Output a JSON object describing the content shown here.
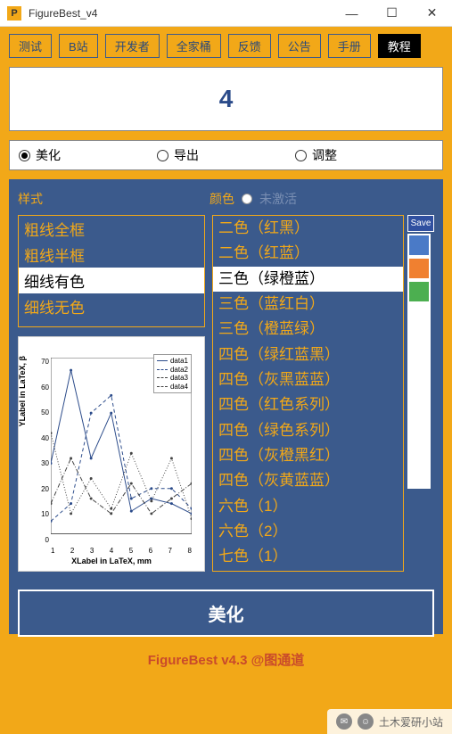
{
  "window": {
    "title": "FigureBest_v4",
    "icon_letter": "P"
  },
  "toolbar": {
    "buttons": [
      "测试",
      "B站",
      "开发者",
      "全家桶",
      "反馈",
      "公告",
      "手册",
      "教程"
    ]
  },
  "display": {
    "value": "4"
  },
  "tabs": {
    "options": [
      "美化",
      "导出",
      "调整"
    ],
    "selected": 0
  },
  "panel": {
    "style_header": "样式",
    "color_header": "颜色",
    "inactive_label": "未激活",
    "styles": [
      "粗线全框",
      "粗线半框",
      "细线有色",
      "细线无色"
    ],
    "selected_style": 2,
    "colors": [
      "二色（红黑）",
      "二色（红蓝）",
      "三色（绿橙蓝）",
      "三色（蓝红白）",
      "三色（橙蓝绿）",
      "四色（绿红蓝黑）",
      "四色（灰黑蓝蓝）",
      "四色（红色系列）",
      "四色（绿色系列）",
      "四色（灰橙黑红）",
      "四色（灰黄蓝蓝）",
      "六色（1）",
      "六色（2）",
      "七色（1）"
    ],
    "selected_color": 2,
    "save_label": "Save",
    "swatches": [
      "#4a7ac7",
      "#f08030",
      "#4caf50",
      "#ffffff",
      "#ffffff",
      "#ffffff",
      "#ffffff",
      "#ffffff",
      "#ffffff",
      "#ffffff",
      "#ffffff"
    ]
  },
  "action": {
    "label": "美化"
  },
  "footer": {
    "text": "FigureBest v4.3 @图通道"
  },
  "wechat": {
    "label": "土木爱研小站"
  },
  "chart_data": {
    "type": "line",
    "xlabel": "XLabel in LaTeX, mm",
    "ylabel": "YLabel in LaTeX, β",
    "x": [
      1,
      2,
      3,
      4,
      5,
      6,
      7,
      8
    ],
    "xlim": [
      1,
      8
    ],
    "ylim": [
      0,
      70
    ],
    "y_ticks": [
      0,
      10,
      20,
      30,
      40,
      50,
      60,
      70
    ],
    "x_ticks": [
      1,
      2,
      3,
      4,
      5,
      6,
      7,
      8
    ],
    "series": [
      {
        "name": "data1",
        "style": "solid",
        "color": "#2b4b8a",
        "values": [
          28,
          65,
          30,
          48,
          9,
          14,
          12,
          8
        ]
      },
      {
        "name": "data2",
        "style": "dash",
        "color": "#2b4b8a",
        "values": [
          5,
          12,
          48,
          55,
          14,
          18,
          18,
          10
        ]
      },
      {
        "name": "data3",
        "style": "dot",
        "color": "#444",
        "values": [
          40,
          8,
          22,
          10,
          32,
          13,
          30,
          6
        ]
      },
      {
        "name": "data4",
        "style": "dashdot",
        "color": "#444",
        "values": [
          12,
          30,
          14,
          8,
          20,
          8,
          14,
          20
        ]
      }
    ],
    "legend_position": "upper-right"
  }
}
